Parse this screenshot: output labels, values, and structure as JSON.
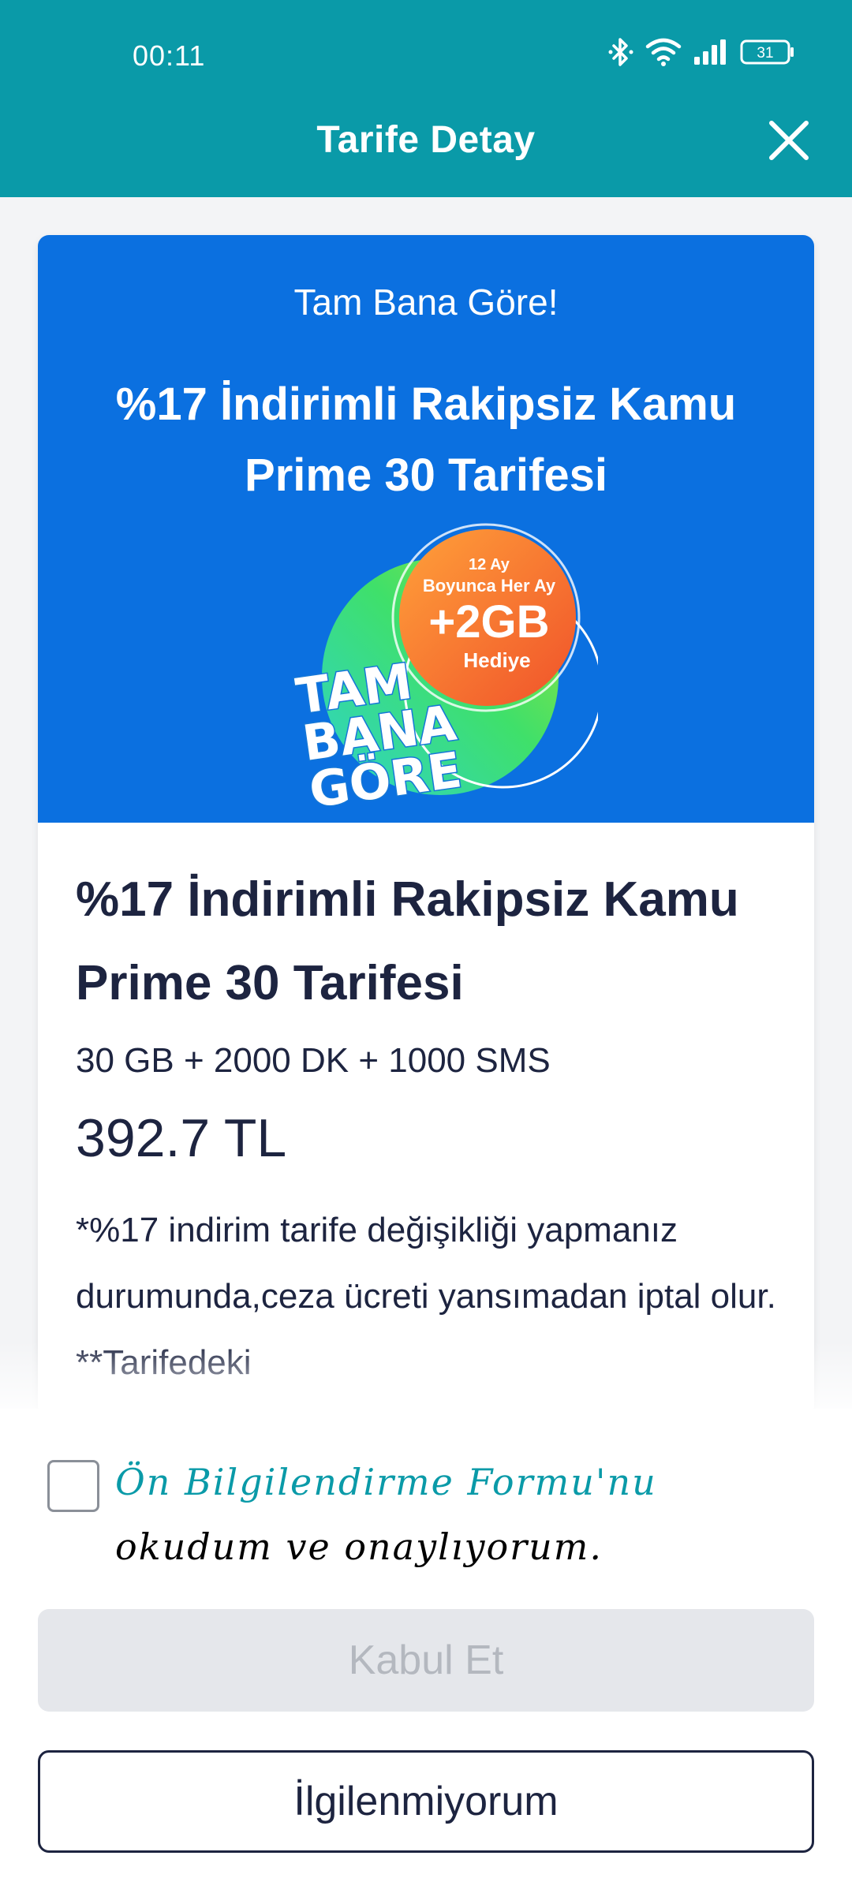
{
  "status_bar": {
    "time": "00:11",
    "battery": "31"
  },
  "header": {
    "title": "Tarife Detay",
    "close_icon": "close-icon"
  },
  "banner": {
    "subtitle": "Tam Bana Göre!",
    "title": "%17 İndirimli Rakipsiz Kamu Prime 30 Tarifesi",
    "badge": {
      "line1": "12 Ay",
      "line2": "Boyunca Her Ay",
      "amount": "+2GB",
      "gift": "Hediye",
      "slogan1": "TAM",
      "slogan2": "BANA",
      "slogan3": "GÖRE"
    }
  },
  "plan": {
    "title": "%17 İndirimli Rakipsiz Kamu Prime 30 Tarifesi",
    "allowance": "30 GB + 2000 DK + 1000 SMS",
    "price": "392.7 TL",
    "note": "*%17 indirim tarife değişikliği yapmanız durumunda,ceza ücreti yansımadan iptal olur. **Tarifedeki"
  },
  "consent": {
    "link_text": "Ön Bilgilendirme Formu'nu",
    "rest_text": " okudum ve onaylıyorum.",
    "checked": false
  },
  "actions": {
    "accept_label": "Kabul Et",
    "decline_label": "İlgilenmiyorum"
  },
  "colors": {
    "appbar": "#0a9aa8",
    "banner": "#0b70e0",
    "text": "#1d2440"
  }
}
